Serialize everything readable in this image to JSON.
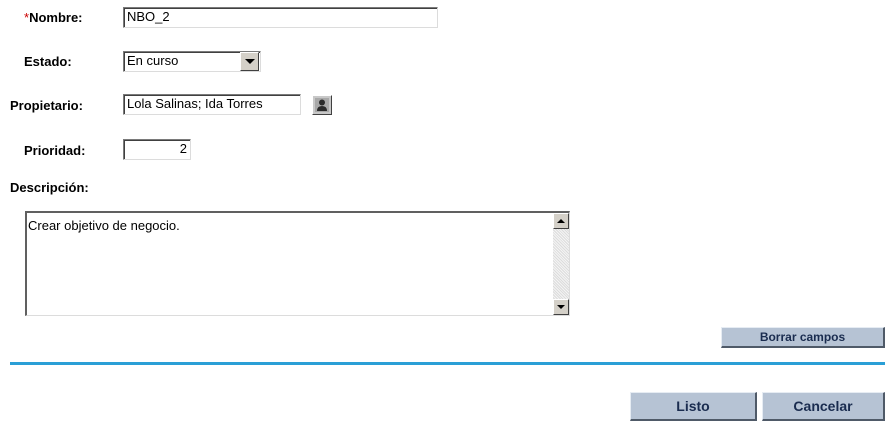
{
  "form": {
    "nombre": {
      "required_mark": "*",
      "label": "Nombre:",
      "value": "NBO_2"
    },
    "estado": {
      "label": "Estado:",
      "value": "En curso"
    },
    "propietario": {
      "label": "Propietario:",
      "value": "Lola Salinas; Ida Torres",
      "picker_icon": "user-icon"
    },
    "prioridad": {
      "label": "Prioridad:",
      "value": "2"
    },
    "descripcion": {
      "label": "Descripción:",
      "value": "Crear objetivo de negocio."
    }
  },
  "buttons": {
    "clear_label": "Borrar campos",
    "done_label": "Listo",
    "cancel_label": "Cancelar"
  },
  "colors": {
    "divider": "#2a9fd6",
    "button_bg": "#b6c3d4",
    "button_text": "#1a2c4f",
    "required_mark": "#cc0000"
  }
}
